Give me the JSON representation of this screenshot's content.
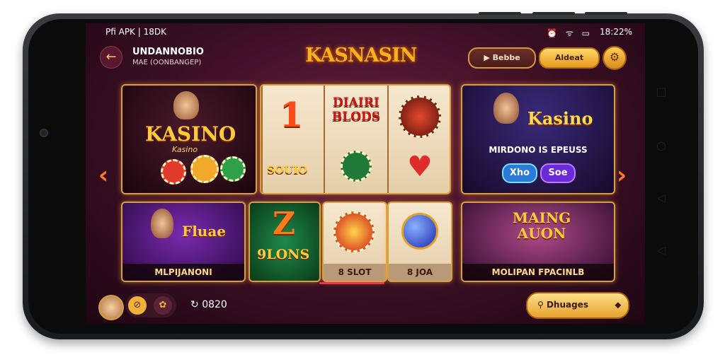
{
  "status_bar": {
    "left": "Pfi APK | 18DK",
    "right": "18:22%"
  },
  "header": {
    "title": "UNDANNOBIO",
    "subtitle": "MAE (OONBANGEP)",
    "logo": "KASNASIN",
    "button1": "Bebbe",
    "button2": "Aldeat"
  },
  "cards": {
    "kasino": {
      "title": "KASINO",
      "sub": "Kasino"
    },
    "slots": {
      "r1": "1",
      "r2": "DIAIRI BLODS",
      "r3": "SOUIO"
    },
    "featured": {
      "title": "Kasino",
      "caption": "MIRDONO IS EPEUSS",
      "chip1": "Xho",
      "chip2": "Soe"
    },
    "bottom1": {
      "title": "Fluae",
      "caption": "MLPIJANONI"
    },
    "bottom2": {
      "title": "Z",
      "sub": "9LONS"
    },
    "bottom3": {
      "caption": "8 SLOT"
    },
    "bottom4": {
      "caption": "8 JOA"
    },
    "bottom5": {
      "title": "MAING AUON",
      "caption": "MOLIPAN FPACINLB"
    }
  },
  "bottom_bar": {
    "coins": "0820",
    "search": "Dhuages"
  },
  "colors": {
    "accent": "#d9a03a",
    "bg": "#3a0f24",
    "gold": "#ffcb3b"
  }
}
